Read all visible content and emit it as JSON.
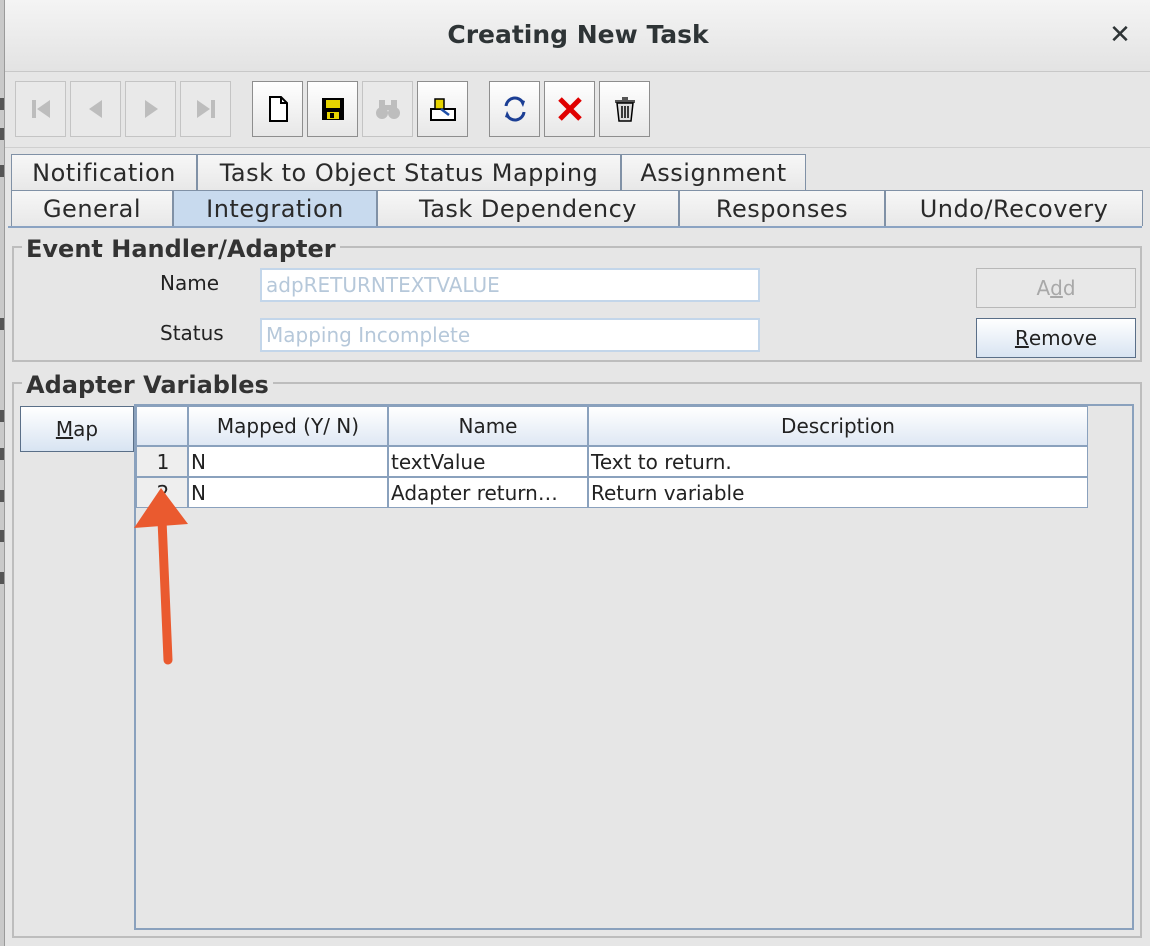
{
  "window": {
    "title": "Creating New Task",
    "close_glyph": "✕"
  },
  "toolbar": {
    "buttons": [
      {
        "icon": "first-record-icon",
        "enabled": false
      },
      {
        "icon": "previous-record-icon",
        "enabled": false
      },
      {
        "icon": "next-record-icon",
        "enabled": false
      },
      {
        "icon": "last-record-icon",
        "enabled": false
      },
      {
        "icon": "new-document-icon",
        "enabled": true
      },
      {
        "icon": "save-icon",
        "enabled": true
      },
      {
        "icon": "binoculars-icon",
        "enabled": false
      },
      {
        "icon": "assign-icon",
        "enabled": true
      },
      {
        "icon": "refresh-icon",
        "enabled": true
      },
      {
        "icon": "delete-x-icon",
        "enabled": true
      },
      {
        "icon": "trash-icon",
        "enabled": true
      }
    ]
  },
  "tabs": {
    "row1": [
      "Notification",
      "Task to Object Status Mapping",
      "Assignment"
    ],
    "row2": [
      "General",
      "Integration",
      "Task Dependency",
      "Responses",
      "Undo/Recovery"
    ],
    "active": "Integration"
  },
  "event_handler": {
    "title": "Event Handler/Adapter",
    "name_label": "Name",
    "name_value": "adpRETURNTEXTVALUE",
    "status_label": "Status",
    "status_value": "Mapping Incomplete",
    "add_label_pre": "A",
    "add_label_mnemonic": "d",
    "add_label_post": "d",
    "remove_label_mnemonic": "R",
    "remove_label_post": "emove"
  },
  "adapter_variables": {
    "title": "Adapter Variables",
    "map_label_mnemonic": "M",
    "map_label_post": "ap",
    "columns": [
      "",
      "Mapped (Y/ N)",
      "Name",
      "Description"
    ],
    "rows": [
      {
        "num": "1",
        "mapped": "N",
        "name": "textValue",
        "description": "Text to return."
      },
      {
        "num": "2",
        "mapped": "N",
        "name": "Adapter return…",
        "description": "Return variable"
      }
    ]
  },
  "colors": {
    "annotation_arrow": "#ea5a2f",
    "active_tab": "#c8daee",
    "border_blue": "#8aa1bd"
  }
}
